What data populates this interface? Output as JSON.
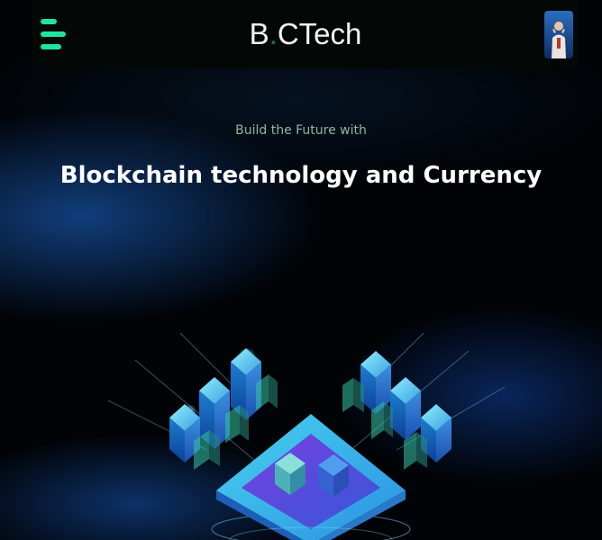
{
  "header": {
    "brand_left": "B",
    "brand_dot": ".",
    "brand_right": "CTech",
    "menu_icon": "hamburger-menu-icon",
    "avatar": "profile-avatar"
  },
  "hero": {
    "tagline": "Build the Future with",
    "headline": "Blockchain technology and Currency",
    "illustration": "blockchain-network-illustration"
  },
  "colors": {
    "accent": "#1fe3a3",
    "background": "#010307",
    "tagline": "#8fb6a2",
    "glow": "#1e6edc"
  }
}
